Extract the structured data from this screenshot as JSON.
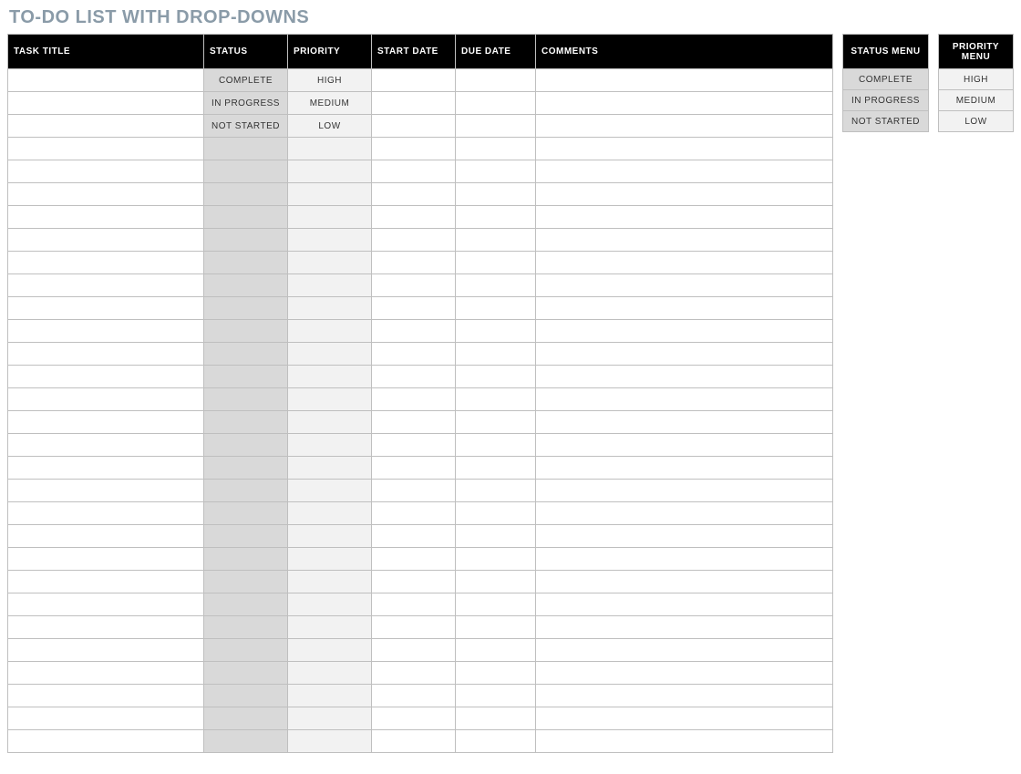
{
  "title": "TO-DO LIST WITH DROP-DOWNS",
  "main": {
    "headers": {
      "task": "TASK TITLE",
      "status": "STATUS",
      "priority": "PRIORITY",
      "start": "START DATE",
      "due": "DUE DATE",
      "comments": "COMMENTS"
    },
    "rows": [
      {
        "task": "",
        "status": "COMPLETE",
        "priority": "HIGH",
        "start": "",
        "due": "",
        "comments": ""
      },
      {
        "task": "",
        "status": "IN PROGRESS",
        "priority": "MEDIUM",
        "start": "",
        "due": "",
        "comments": ""
      },
      {
        "task": "",
        "status": "NOT STARTED",
        "priority": "LOW",
        "start": "",
        "due": "",
        "comments": ""
      },
      {
        "task": "",
        "status": "",
        "priority": "",
        "start": "",
        "due": "",
        "comments": ""
      },
      {
        "task": "",
        "status": "",
        "priority": "",
        "start": "",
        "due": "",
        "comments": ""
      },
      {
        "task": "",
        "status": "",
        "priority": "",
        "start": "",
        "due": "",
        "comments": ""
      },
      {
        "task": "",
        "status": "",
        "priority": "",
        "start": "",
        "due": "",
        "comments": ""
      },
      {
        "task": "",
        "status": "",
        "priority": "",
        "start": "",
        "due": "",
        "comments": ""
      },
      {
        "task": "",
        "status": "",
        "priority": "",
        "start": "",
        "due": "",
        "comments": ""
      },
      {
        "task": "",
        "status": "",
        "priority": "",
        "start": "",
        "due": "",
        "comments": ""
      },
      {
        "task": "",
        "status": "",
        "priority": "",
        "start": "",
        "due": "",
        "comments": ""
      },
      {
        "task": "",
        "status": "",
        "priority": "",
        "start": "",
        "due": "",
        "comments": ""
      },
      {
        "task": "",
        "status": "",
        "priority": "",
        "start": "",
        "due": "",
        "comments": ""
      },
      {
        "task": "",
        "status": "",
        "priority": "",
        "start": "",
        "due": "",
        "comments": ""
      },
      {
        "task": "",
        "status": "",
        "priority": "",
        "start": "",
        "due": "",
        "comments": ""
      },
      {
        "task": "",
        "status": "",
        "priority": "",
        "start": "",
        "due": "",
        "comments": ""
      },
      {
        "task": "",
        "status": "",
        "priority": "",
        "start": "",
        "due": "",
        "comments": ""
      },
      {
        "task": "",
        "status": "",
        "priority": "",
        "start": "",
        "due": "",
        "comments": ""
      },
      {
        "task": "",
        "status": "",
        "priority": "",
        "start": "",
        "due": "",
        "comments": ""
      },
      {
        "task": "",
        "status": "",
        "priority": "",
        "start": "",
        "due": "",
        "comments": ""
      },
      {
        "task": "",
        "status": "",
        "priority": "",
        "start": "",
        "due": "",
        "comments": ""
      },
      {
        "task": "",
        "status": "",
        "priority": "",
        "start": "",
        "due": "",
        "comments": ""
      },
      {
        "task": "",
        "status": "",
        "priority": "",
        "start": "",
        "due": "",
        "comments": ""
      },
      {
        "task": "",
        "status": "",
        "priority": "",
        "start": "",
        "due": "",
        "comments": ""
      },
      {
        "task": "",
        "status": "",
        "priority": "",
        "start": "",
        "due": "",
        "comments": ""
      },
      {
        "task": "",
        "status": "",
        "priority": "",
        "start": "",
        "due": "",
        "comments": ""
      },
      {
        "task": "",
        "status": "",
        "priority": "",
        "start": "",
        "due": "",
        "comments": ""
      },
      {
        "task": "",
        "status": "",
        "priority": "",
        "start": "",
        "due": "",
        "comments": ""
      },
      {
        "task": "",
        "status": "",
        "priority": "",
        "start": "",
        "due": "",
        "comments": ""
      },
      {
        "task": "",
        "status": "",
        "priority": "",
        "start": "",
        "due": "",
        "comments": ""
      }
    ]
  },
  "menus": {
    "status": {
      "header": "STATUS MENU",
      "items": [
        "COMPLETE",
        "IN PROGRESS",
        "NOT STARTED"
      ]
    },
    "priority": {
      "header": "PRIORITY MENU",
      "items": [
        "HIGH",
        "MEDIUM",
        "LOW"
      ]
    }
  }
}
